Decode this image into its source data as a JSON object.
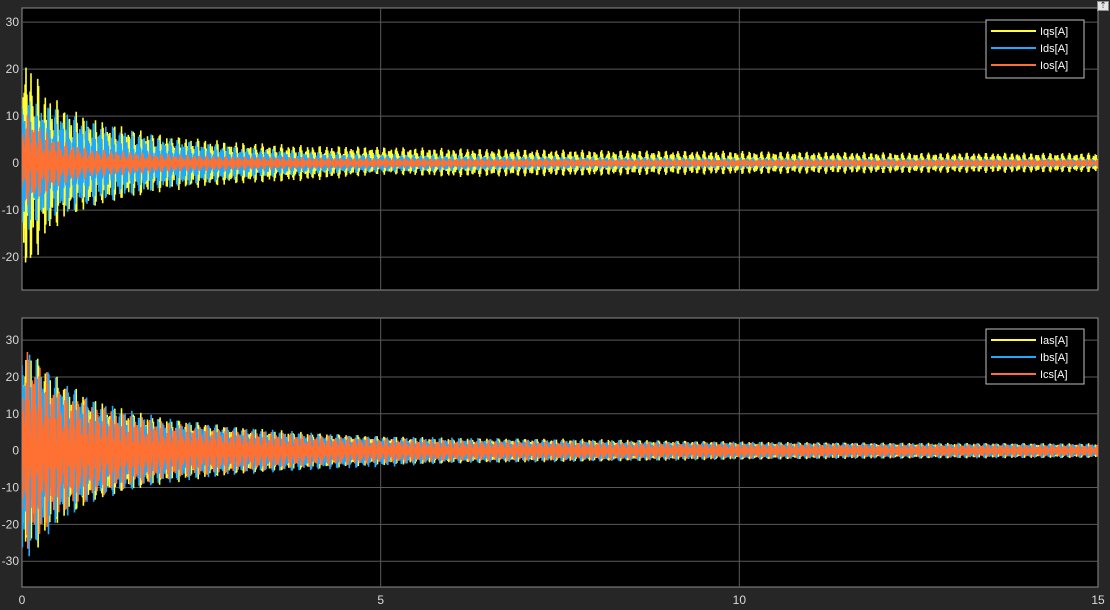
{
  "window": {
    "restore_icon": "arrow-up-icon",
    "restore_glyph": "⇡"
  },
  "colors": {
    "background": "#262626",
    "plot_background": "#000000",
    "grid": "#5a5a5a",
    "axis": "#8c8c8c",
    "tick_text": "#d9d9d9",
    "series": [
      "#ffff33",
      "#1fa9ff",
      "#ff7133"
    ]
  },
  "chart_data": [
    {
      "type": "line",
      "title": "",
      "xlabel": "",
      "ylabel": "",
      "xlim": [
        0,
        15
      ],
      "ylim": [
        -27,
        33
      ],
      "xticks": [
        0,
        5,
        10,
        15
      ],
      "yticks": [
        -20,
        -10,
        0,
        10,
        20,
        30
      ],
      "grid": true,
      "legend_position": "top-right",
      "series": [
        {
          "name": "Iqs[A]",
          "color": "#ffff33",
          "envelope": {
            "x": [
              0,
              0.1,
              0.3,
              0.6,
              1,
              1.5,
              2,
              3,
              4,
              5,
              6,
              8,
              10,
              12,
              15
            ],
            "upper": [
              25,
              22,
              16,
              12,
              9.5,
              7.5,
              6,
              4.5,
              3.8,
              3.5,
              3.2,
              2.8,
              2.6,
              2.3,
              2.2
            ],
            "lower": [
              -26,
              -24,
              -17,
              -12,
              -9.5,
              -7.5,
              -6,
              -4.5,
              -3.8,
              -2.5,
              -3,
              -2.7,
              -2.4,
              -2.2,
              -2.0
            ]
          }
        },
        {
          "name": "Ids[A]",
          "color": "#1fa9ff",
          "envelope": {
            "x": [
              0,
              0.3,
              0.6,
              1,
              1.5,
              2,
              3,
              4,
              5,
              6,
              8,
              10,
              12,
              15
            ],
            "upper": [
              14,
              13,
              11,
              9,
              7,
              5.5,
              3.5,
              2.5,
              2,
              1.8,
              1.4,
              1.2,
              1.1,
              1.0
            ],
            "lower": [
              -15,
              -13,
              -11,
              -9,
              -7,
              -5.5,
              -3.5,
              -2.5,
              -2,
              -1.8,
              -1.4,
              -1.2,
              -1.1,
              -1.0
            ]
          }
        },
        {
          "name": "Ios[A]",
          "color": "#ff7133",
          "envelope": {
            "x": [
              0,
              0.3,
              0.6,
              1,
              2,
              3,
              5,
              8,
              12,
              15
            ],
            "upper": [
              12,
              7,
              4.5,
              3,
              2,
              1.5,
              1.1,
              0.9,
              0.8,
              0.8
            ],
            "lower": [
              -10,
              -7,
              -4.5,
              -3,
              -2,
              -1.5,
              -1.1,
              -0.9,
              -0.8,
              -0.8
            ]
          }
        }
      ]
    },
    {
      "type": "line",
      "title": "",
      "xlabel": "",
      "ylabel": "",
      "xlim": [
        0,
        15
      ],
      "ylim": [
        -37,
        36
      ],
      "xticks": [
        0,
        5,
        10,
        15
      ],
      "yticks": [
        -30,
        -20,
        -10,
        0,
        10,
        20,
        30
      ],
      "grid": true,
      "legend_position": "top-right",
      "series": [
        {
          "name": "Ias[A]",
          "color": "#ffff33",
          "envelope": {
            "x": [
              0,
              0.2,
              0.5,
              1,
              1.5,
              2,
              3,
              4,
              5,
              6,
              8,
              10,
              12,
              15
            ],
            "upper": [
              29,
              26,
              20,
              14,
              11,
              9,
              6.5,
              5,
              4,
              3.5,
              3.2,
              2.5,
              2.2,
              2.0
            ],
            "lower": [
              -30,
              -27,
              -20,
              -14,
              -11,
              -9,
              -6.5,
              -5,
              -4,
              -3.5,
              -3,
              -2.5,
              -2.2,
              -2.0
            ]
          }
        },
        {
          "name": "Ibs[A]",
          "color": "#1fa9ff",
          "envelope": {
            "x": [
              0,
              0.2,
              0.5,
              1,
              1.5,
              2,
              3,
              4,
              5,
              6,
              8,
              10,
              12,
              15
            ],
            "upper": [
              28,
              26,
              20,
              14,
              11,
              9,
              6.5,
              5,
              4,
              3.6,
              3,
              2.5,
              2.2,
              2.0
            ],
            "lower": [
              -31,
              -27,
              -20,
              -14,
              -11,
              -9,
              -6.5,
              -5.5,
              -4.5,
              -3.5,
              -3,
              -2.5,
              -2.2,
              -2.0
            ]
          }
        },
        {
          "name": "Ics[A]",
          "color": "#ff7133",
          "envelope": {
            "x": [
              0,
              0.2,
              0.5,
              1,
              1.5,
              2,
              3,
              4,
              5,
              6,
              8,
              10,
              12,
              15
            ],
            "upper": [
              30,
              25,
              18,
              13,
              10,
              8,
              6,
              4.5,
              3.5,
              3,
              2.6,
              2.2,
              1.9,
              1.7
            ],
            "lower": [
              -29,
              -25,
              -18,
              -13,
              -10,
              -8,
              -6,
              -4.5,
              -3.5,
              -3,
              -2.6,
              -2.2,
              -1.9,
              -1.7
            ]
          }
        }
      ]
    }
  ]
}
